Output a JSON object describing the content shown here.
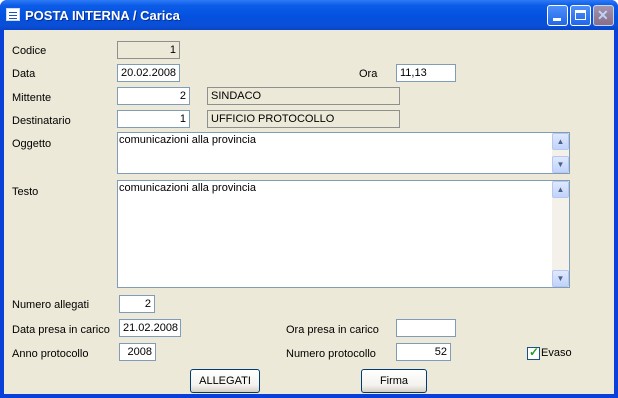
{
  "window": {
    "title": "POSTA INTERNA / Carica",
    "close_symbol": "✕"
  },
  "form": {
    "codice": {
      "label": "Codice",
      "value": "1"
    },
    "data": {
      "label": "Data",
      "value": "20.02.2008"
    },
    "ora": {
      "label": "Ora",
      "value": "11,13"
    },
    "mittente": {
      "label": "Mittente",
      "code": "2",
      "name": "SINDACO"
    },
    "destinatario": {
      "label": "Destinatario",
      "code": "1",
      "name": "UFFICIO PROTOCOLLO"
    },
    "oggetto": {
      "label": "Oggetto",
      "value": "comunicazioni alla provincia"
    },
    "testo": {
      "label": "Testo",
      "value": "comunicazioni alla provincia"
    },
    "numero_allegati": {
      "label": "Numero allegati",
      "value": "2"
    },
    "data_presa_in_carico": {
      "label": "Data presa in carico",
      "value": "21.02.2008"
    },
    "ora_presa_in_carico": {
      "label": "Ora presa in carico",
      "value": ""
    },
    "anno_protocollo": {
      "label": "Anno protocollo",
      "value": "2008"
    },
    "numero_protocollo": {
      "label": "Numero protocollo",
      "value": "52"
    },
    "evaso": {
      "label": "Evaso",
      "checked": true,
      "check_glyph": "✓"
    }
  },
  "buttons": {
    "allegati": "ALLEGATI",
    "firma": "Firma"
  },
  "scroll": {
    "up": "▲",
    "down": "▼"
  }
}
